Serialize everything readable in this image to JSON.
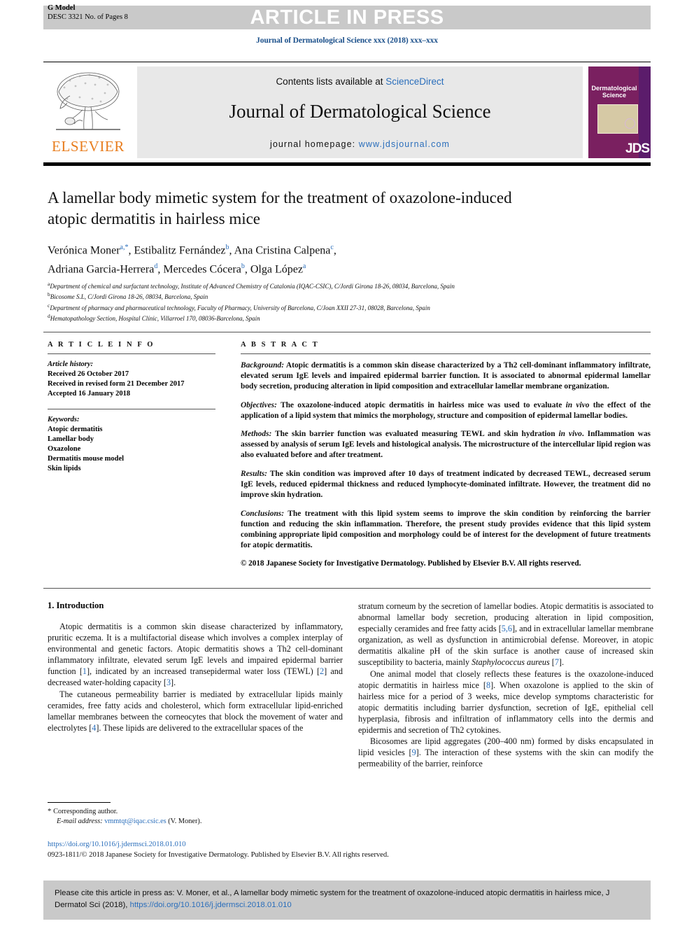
{
  "banner": {
    "article_in_press": "ARTICLE IN PRESS",
    "g_model": "G Model",
    "desc_line": "DESC 3321 No. of Pages 8"
  },
  "running_head": "Journal of Dermatological Science xxx (2018) xxx–xxx",
  "masthead": {
    "publisher_name": "ELSEVIER",
    "contents_prefix": "Contents lists available at ",
    "sciencedirect": "ScienceDirect",
    "journal_title": "Journal of Dermatological Science",
    "homepage_prefix": "journal homepage: ",
    "homepage_url": "www.jdsjournal.com",
    "cover": {
      "title": "Dermatological Science",
      "acronym": "JDS"
    }
  },
  "article": {
    "title": "A lamellar body mimetic system for the treatment of oxazolone-induced atopic dermatitis in hairless mice",
    "authors_line_1": "Verónica Moner",
    "authors": [
      {
        "name": "Verónica Moner",
        "sup": "a,*"
      },
      {
        "name": "Estibalitz Fernández",
        "sup": "b"
      },
      {
        "name": "Ana Cristina Calpena",
        "sup": "c"
      },
      {
        "name": "Adriana Garcia-Herrera",
        "sup": "d"
      },
      {
        "name": "Mercedes Cócera",
        "sup": "b"
      },
      {
        "name": "Olga López",
        "sup": "a"
      }
    ],
    "affiliations": [
      {
        "sup": "a",
        "text": "Department of chemical and surfactant technology, Institute of Advanced Chemistry of Catalonia (IQAC-CSIC), C/Jordi Girona 18-26, 08034, Barcelona, Spain"
      },
      {
        "sup": "b",
        "text": "Bicosome S.L, C/Jordi Girona 18-26, 08034, Barcelona, Spain"
      },
      {
        "sup": "c",
        "text": "Department of pharmacy and pharmaceutical technology, Faculty of Pharmacy, University of Barcelona, C/Joan XXII 27-31, 08028, Barcelona, Spain"
      },
      {
        "sup": "d",
        "text": "Hematopathology Section, Hospital Clínic, Villarroel 170, 08036-Barcelona, Spain"
      }
    ]
  },
  "article_info": {
    "heading": "A R T I C L E   I N F O",
    "history_label": "Article history:",
    "history": [
      "Received 26 October 2017",
      "Received in revised form 21 December 2017",
      "Accepted 16 January 2018"
    ],
    "keywords_label": "Keywords:",
    "keywords": [
      "Atopic dermatitis",
      "Lamellar body",
      "Oxazolone",
      "Dermatitis mouse model",
      "Skin lipids"
    ]
  },
  "abstract": {
    "heading": "A B S T R A C T",
    "sections": [
      {
        "label": "Background:",
        "text": " Atopic dermatitis is a common skin disease characterized by a Th2 cell-dominant inflammatory infiltrate, elevated serum IgE levels and impaired epidermal barrier function. It is associated to abnormal epidermal lamellar body secretion, producing alteration in lipid composition and extracellular lamellar membrane organization."
      },
      {
        "label": "Objectives:",
        "text": " The oxazolone-induced atopic dermatitis in hairless mice was used to evaluate in vivo the effect of the application of a lipid system that mimics the morphology, structure and composition of epidermal lamellar bodies."
      },
      {
        "label": "Methods:",
        "text": " The skin barrier function was evaluated measuring TEWL and skin hydration in vivo. Inflammation was assessed by analysis of serum IgE levels and histological analysis. The microstructure of the intercellular lipid region was also evaluated before and after treatment."
      },
      {
        "label": "Results:",
        "text": " The skin condition was improved after 10 days of treatment indicated by decreased TEWL, decreased serum IgE levels, reduced epidermal thickness and reduced lymphocyte-dominated infiltrate. However, the treatment did no improve skin hydration."
      },
      {
        "label": "Conclusions:",
        "text": " The treatment with this lipid system seems to improve the skin condition by reinforcing the barrier function and reducing the skin inflammation. Therefore, the present study provides evidence that this lipid system combining appropriate lipid composition and morphology could be of interest for the development of future treatments for atopic dermatitis."
      }
    ],
    "copyright": "© 2018 Japanese Society for Investigative Dermatology. Published by Elsevier B.V. All rights reserved."
  },
  "body": {
    "section_title": "1. Introduction",
    "left_paragraphs": [
      "Atopic dermatitis is a common skin disease characterized by inflammatory, pruritic eczema. It is a multifactorial disease which involves a complex interplay of environmental and genetic factors. Atopic dermatitis shows a Th2 cell-dominant inflammatory infiltrate, elevated serum IgE levels and impaired epidermal barrier function [1], indicated by an increased transepidermal water loss (TEWL) [2] and decreased water-holding capacity [3].",
      "The cutaneous permeability barrier is mediated by extracellular lipids mainly ceramides, free fatty acids and cholesterol, which form extracellular lipid-enriched lamellar membranes between the corneocytes that block the movement of water and electrolytes [4]. These lipids are delivered to the extracellular spaces of the"
    ],
    "right_paragraphs": [
      "stratum corneum by the secretion of lamellar bodies. Atopic dermatitis is associated to abnormal lamellar body secretion, producing alteration in lipid composition, especially ceramides and free fatty acids [5,6], and in extracellular lamellar membrane organization, as well as dysfunction in antimicrobial defense. Moreover, in atopic dermatitis alkaline pH of the skin surface is another cause of increased skin susceptibility to bacteria, mainly Staphylococcus aureus [7].",
      "One animal model that closely reflects these features is the oxazolone-induced atopic dermatitis in hairless mice [8]. When oxazolone is applied to the skin of hairless mice for a period of 3 weeks, mice develop symptoms characteristic for atopic dermatitis including barrier dysfunction, secretion of IgE, epithelial cell hyperplasia, fibrosis and infiltration of inflammatory cells into the dermis and epidermis and secretion of Th2 cytokines.",
      "Bicosomes are lipid aggregates (200–400 nm) formed by disks encapsulated in lipid vesicles [9]. The interaction of these systems with the skin can modify the permeability of the barrier, reinforce"
    ]
  },
  "footnote": {
    "corresponding_marker": "*",
    "corresponding_text": "Corresponding author.",
    "email_label": "E-mail address:",
    "email": "vmmtqt@iqac.csic.es",
    "email_owner": "(V. Moner)."
  },
  "footer": {
    "doi_url": "https://doi.org/10.1016/j.jdermsci.2018.01.010",
    "issn_line": "0923-1811/© 2018 Japanese Society for Investigative Dermatology. Published by Elsevier B.V. All rights reserved."
  },
  "cite_box": {
    "text_before": "Please cite this article in press as: V. Moner, et al., A lamellar body mimetic system for the treatment of oxazolone-induced atopic dermatitis in hairless mice, J Dermatol Sci (2018), ",
    "doi": "https://doi.org/10.1016/j.jdermsci.2018.01.010"
  },
  "colors": {
    "link": "#2a6ebb",
    "banner_gray": "#c9c9c9",
    "elsevier_orange": "#e87d1e",
    "cover_purple": "#7a2060"
  }
}
